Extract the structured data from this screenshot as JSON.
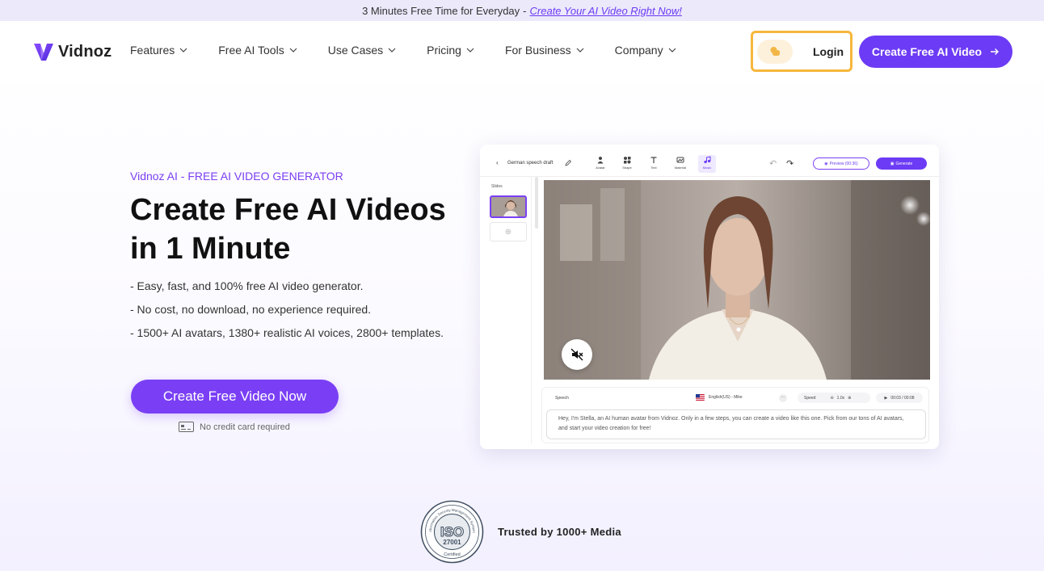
{
  "announcement": {
    "text": "3 Minutes Free Time for Everyday",
    "separator": "-",
    "link": "Create Your AI Video Right Now!"
  },
  "brand": {
    "name": "Vidnoz",
    "color": "#6c3bf5"
  },
  "nav": {
    "items": [
      {
        "label": "Features"
      },
      {
        "label": "Free AI Tools"
      },
      {
        "label": "Use Cases"
      },
      {
        "label": "Pricing"
      },
      {
        "label": "For Business"
      },
      {
        "label": "Company"
      }
    ],
    "login": "Login",
    "cta": "Create Free AI Video"
  },
  "hero": {
    "eyebrow": "Vidnoz AI - FREE AI VIDEO GENERATOR",
    "headline_line1": "Create Free AI Videos",
    "headline_line2": "in 1 Minute",
    "bullets": [
      "- Easy, fast, and 100% free AI video generator.",
      "- No cost, no download, no experience required.",
      "- 1500+ AI avatars, 1380+ realistic AI voices, 2800+ templates."
    ],
    "cta": "Create Free Video Now",
    "note": "No credit card required"
  },
  "editor": {
    "draft_title": "German speech draft",
    "tools": [
      "Avatar",
      "Shape",
      "Text",
      "Material",
      "Music"
    ],
    "active_tool": "Music",
    "preview": "Preview (00:36)",
    "generate": "Generate",
    "slides_label": "Slides",
    "speech_label": "Speech",
    "voice": "English(US) - Mike",
    "speed_label": "Speed",
    "speed_value": "1.0x",
    "time": "00:03 / 00:08",
    "script_text": "Hey, I'm Stella, an AI human avatar from Vidnoz. Only in a few steps, you can create a video like this one. Pick from our tons of AI avatars, and start your video creation for free!"
  },
  "trust": {
    "badge_text": "ISO",
    "badge_number": "27001",
    "badge_arc": "Information Security Management System",
    "badge_footer": "Certified",
    "text": "Trusted by 1000+ Media"
  }
}
